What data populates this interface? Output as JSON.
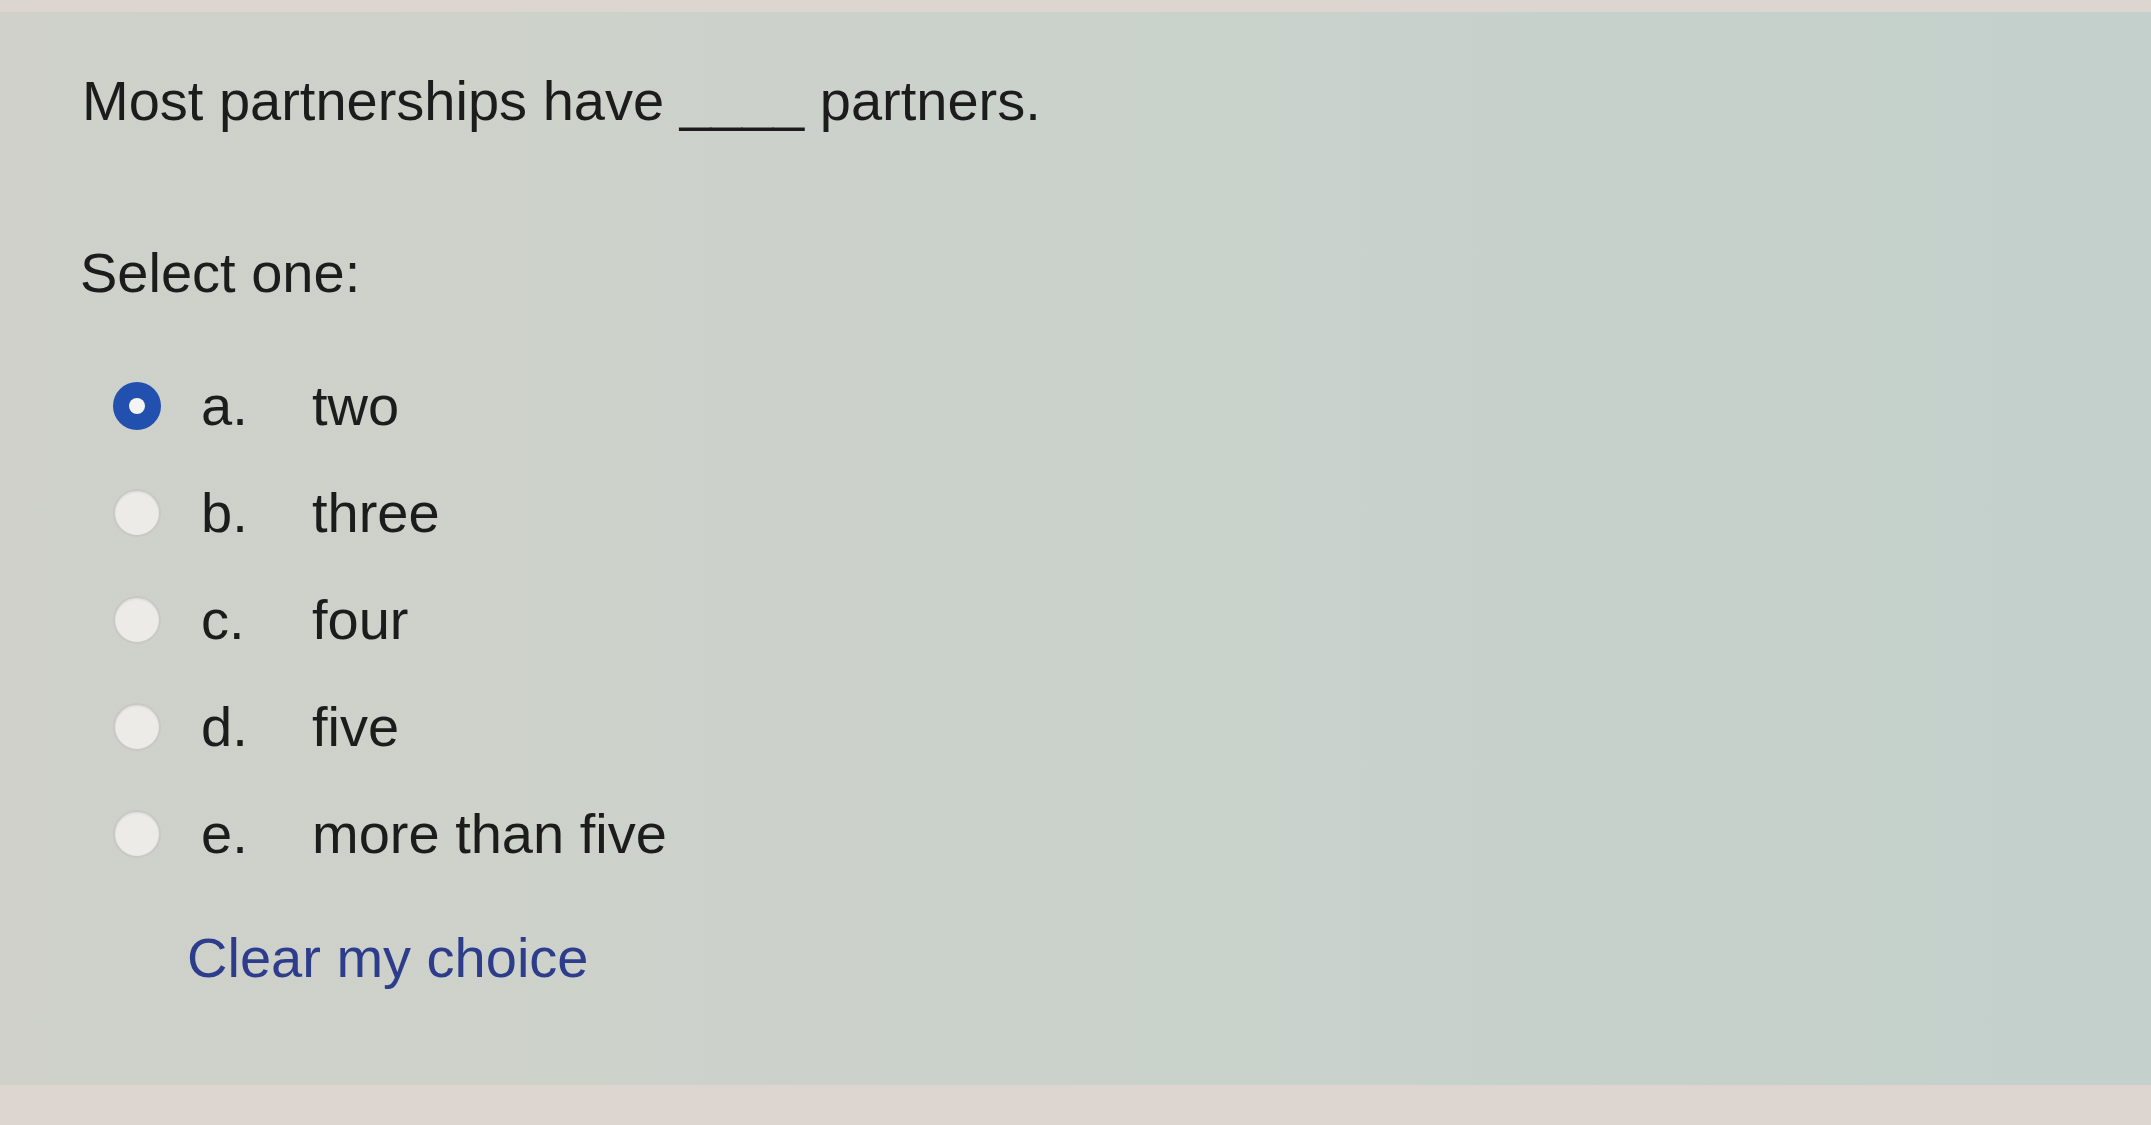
{
  "question": {
    "text": "Most partnerships have ____ partners.",
    "prompt": "Select one:"
  },
  "options": [
    {
      "letter": "a.",
      "label": "two",
      "selected": true
    },
    {
      "letter": "b.",
      "label": "three",
      "selected": false
    },
    {
      "letter": "c.",
      "label": "four",
      "selected": false
    },
    {
      "letter": "d.",
      "label": "five",
      "selected": false
    },
    {
      "letter": "e.",
      "label": "more than five",
      "selected": false
    }
  ],
  "clear_link": "Clear my choice"
}
